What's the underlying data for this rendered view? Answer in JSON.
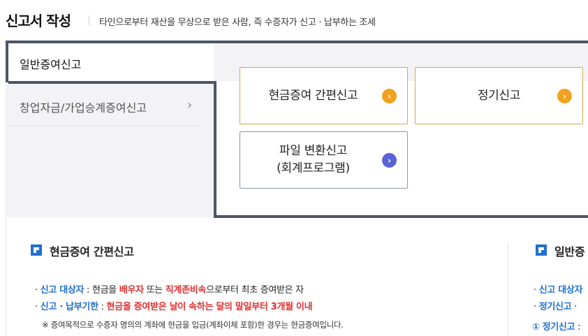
{
  "header": {
    "title": "신고서 작성",
    "description": "타인으로부터 재산을 무상으로 받은 사람, 즉 수증자가 신고 · 납부하는 조세"
  },
  "tabs": {
    "active": "일반증여신고",
    "inactive": "창업자금/가업승계증여신고",
    "inactive_arrow": "›"
  },
  "cards": {
    "cash": {
      "label": "현금증여 간편신고",
      "icon": "chevron-right-icon"
    },
    "regular": {
      "label": "정기신고",
      "icon": "chevron-right-icon"
    },
    "file_line1": "파일 변환신고",
    "file_line2": "(회계프로그램)",
    "chevron": "›"
  },
  "sections": {
    "cash": {
      "title": "현금증여 간편신고",
      "l1_bullet": "·",
      "l1_key": "신고 대상자",
      "l1_t1": " : 현금을 ",
      "l1_r1": "배우자",
      "l1_t2": " 또는 ",
      "l1_r2": "직계존비속",
      "l1_t3": "으로부터 최초 증여받은 자",
      "l2_bullet": "·",
      "l2_key": "신고 · 납부기한",
      "l2_t1": " : ",
      "l2_r1": "현금을 증여받은 날이 속하는 달의 말일부터 3개월 이내",
      "note": "※ 증여목적으로 수증자 명의의 계좌에 현금을 입금(계좌이체 포함)한 경우는 현금증여입니다."
    },
    "general": {
      "title": "일반증",
      "l1_bullet": "·",
      "l1_key": "신고 대상자",
      "l2_bullet": "·",
      "l2_key": "정기신고",
      "l2_t1": " ·",
      "l3_num": "①",
      "l3_key": "정기신고",
      "l3_t1": " :"
    }
  },
  "colors": {
    "accent_blue": "#1f6fd0",
    "accent_red": "#e03030",
    "tab_dark": "#4b5567",
    "orange": "#f0a21e",
    "purple": "#5b63d6"
  }
}
